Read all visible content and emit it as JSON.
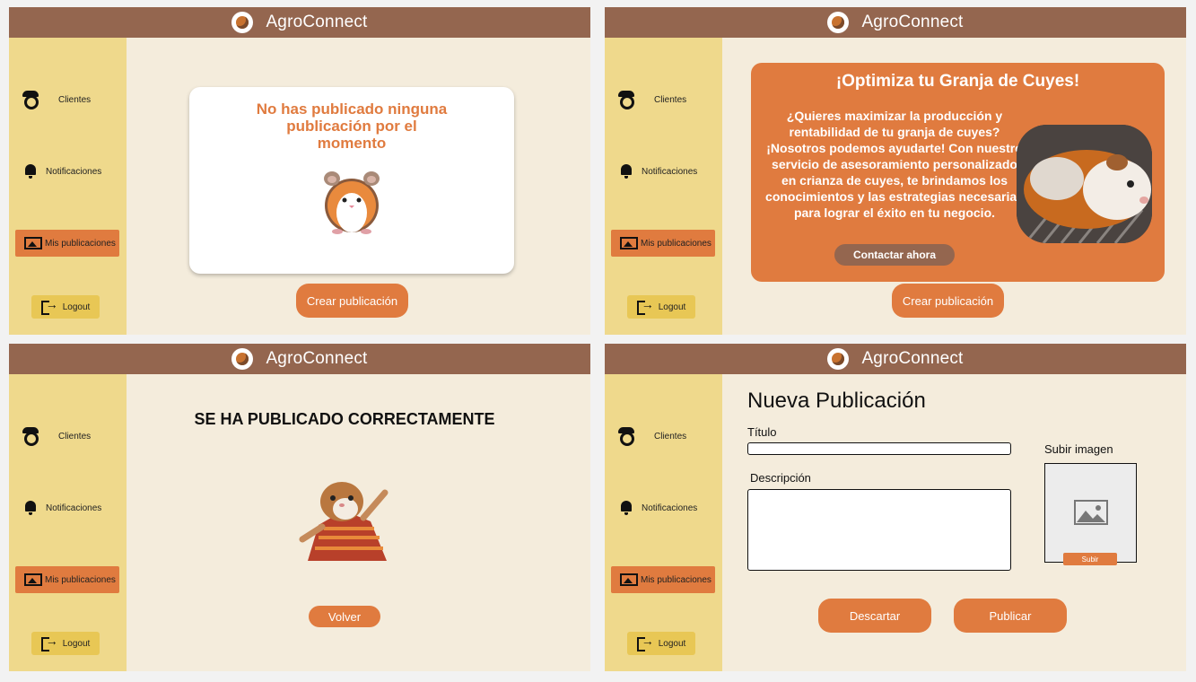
{
  "app": {
    "title": "AgroConnect"
  },
  "sidebar": {
    "items": [
      {
        "label": "Clientes",
        "icon": "farmer-hat-icon"
      },
      {
        "label": "Notificaciones",
        "icon": "bell-icon"
      },
      {
        "label": "Mis publicaciones",
        "icon": "image-icon",
        "active": true
      },
      {
        "label": "Logout",
        "icon": "logout-icon"
      }
    ]
  },
  "screen1": {
    "empty_message": "No has publicado ninguna publicación por el momento",
    "create_button": "Crear publicación"
  },
  "screen2": {
    "promo_title": "¡Optimiza tu Granja de Cuyes!",
    "promo_text": "¿Quieres maximizar la producción y rentabilidad de tu granja de cuyes? ¡Nosotros podemos ayudarte! Con nuestro servicio de asesoramiento personalizado en crianza de cuyes, te brindamos los conocimientos y las estrategias necesarias para lograr el éxito en tu negocio.",
    "contact_button": "Contactar ahora",
    "create_button": "Crear publicación"
  },
  "screen3": {
    "success_message": "SE HA PUBLICADO CORRECTAMENTE",
    "back_button": "Volver"
  },
  "screen4": {
    "page_title": "Nueva Publicación",
    "title_label": "Título",
    "title_value": "",
    "description_label": "Descripción",
    "description_value": "",
    "upload_label": "Subir imagen",
    "upload_button": "Subir",
    "discard_button": "Descartar",
    "publish_button": "Publicar"
  },
  "colors": {
    "topbar": "#94664f",
    "sidebar": "#efd98c",
    "accent": "#e07b3f",
    "background": "#f4ecdc",
    "logout": "#e8c755"
  }
}
